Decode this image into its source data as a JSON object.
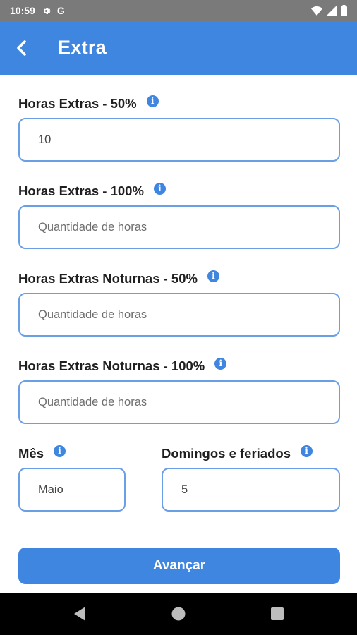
{
  "status_bar": {
    "time": "10:59",
    "g_label": "G",
    "icons": [
      "gear-icon",
      "wifi-icon",
      "signal-icon",
      "battery-icon"
    ]
  },
  "header": {
    "title": "Extra",
    "back_icon": "chevron-left-icon"
  },
  "form": {
    "extras_50": {
      "label": "Horas Extras - 50%",
      "value": "10",
      "placeholder": "Quantidade de horas"
    },
    "extras_100": {
      "label": "Horas Extras - 100%",
      "value": "",
      "placeholder": "Quantidade de horas"
    },
    "noturnas_50": {
      "label": "Horas Extras Noturnas - 50%",
      "value": "",
      "placeholder": "Quantidade de horas"
    },
    "noturnas_100": {
      "label": "Horas Extras Noturnas - 100%",
      "value": "",
      "placeholder": "Quantidade de horas"
    },
    "mes": {
      "label": "Mês",
      "value": "Maio",
      "placeholder": ""
    },
    "domingos": {
      "label": "Domingos e feriados",
      "value": "5",
      "placeholder": ""
    },
    "info_glyph": "i"
  },
  "actions": {
    "advance_label": "Avançar"
  },
  "colors": {
    "primary": "#3f86e0",
    "input_border": "#6a9fe6",
    "status_bar": "#7a7a7a"
  }
}
